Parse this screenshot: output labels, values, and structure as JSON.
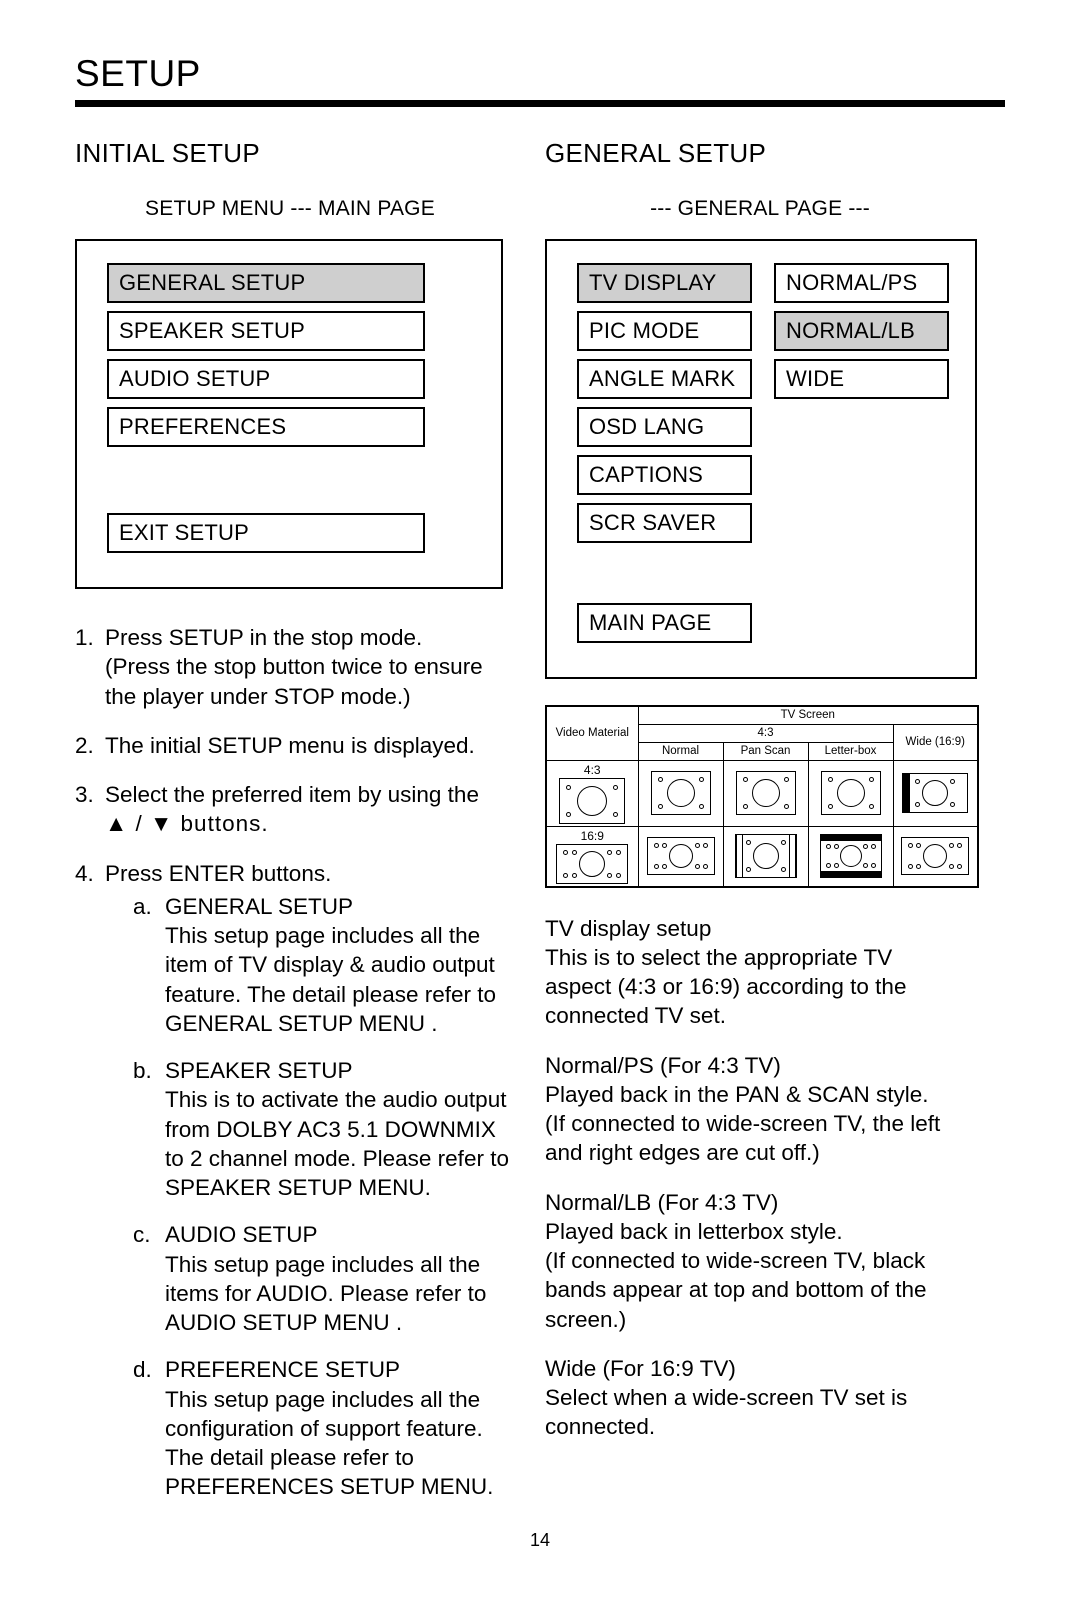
{
  "header": {
    "title": "SETUP"
  },
  "left_column": {
    "section_title": "INITIAL SETUP",
    "menu_caption": "SETUP MENU --- MAIN PAGE",
    "osd_menu": {
      "items": [
        {
          "label": "GENERAL SETUP",
          "selected": true
        },
        {
          "label": "SPEAKER SETUP",
          "selected": false
        },
        {
          "label": "AUDIO SETUP",
          "selected": false
        },
        {
          "label": "PREFERENCES",
          "selected": false
        }
      ],
      "exit_label": "EXIT SETUP"
    },
    "steps": [
      {
        "num": "1.",
        "lines": [
          "Press SETUP in the stop mode.",
          "(Press the stop button twice to ensure",
          "the player under STOP mode.)"
        ]
      },
      {
        "num": "2.",
        "lines": [
          "The initial SETUP menu is displayed."
        ]
      },
      {
        "num": "3.",
        "lines": [
          "Select the preferred item by using the",
          "▲ / ▼ buttons."
        ]
      },
      {
        "num": "4.",
        "lines": [
          "Press ENTER buttons."
        ],
        "subitems": [
          {
            "marker": "a.",
            "heading": "GENERAL SETUP",
            "lines": [
              "This setup page includes all the",
              "item of TV display & audio output",
              "feature.  The detail please refer to",
              "GENERAL SETUP MENU ."
            ]
          },
          {
            "marker": "b.",
            "heading": "SPEAKER SETUP",
            "lines": [
              "This is to activate the audio output",
              "from DOLBY AC3 5.1 DOWNMIX",
              "to 2 channel mode.  Please refer to",
              "SPEAKER SETUP MENU."
            ]
          },
          {
            "marker": "c.",
            "heading": "AUDIO SETUP",
            "lines": [
              "This setup page includes all the",
              "items for AUDIO.  Please refer to",
              "AUDIO SETUP MENU ."
            ]
          },
          {
            "marker": "d.",
            "heading": "PREFERENCE SETUP",
            "lines": [
              "This setup page includes all the",
              "configuration of support feature.",
              "The detail please refer to",
              "PREFERENCES SETUP MENU."
            ]
          }
        ]
      }
    ]
  },
  "right_column": {
    "section_title": "GENERAL SETUP",
    "menu_caption": "--- GENERAL PAGE ---",
    "osd_menu": {
      "left_items": [
        {
          "label": "TV DISPLAY",
          "selected": true
        },
        {
          "label": "PIC MODE",
          "selected": false
        },
        {
          "label": "ANGLE MARK",
          "selected": false
        },
        {
          "label": "OSD LANG",
          "selected": false
        },
        {
          "label": "CAPTIONS",
          "selected": false
        },
        {
          "label": "SCR SAVER",
          "selected": false
        }
      ],
      "right_items": [
        {
          "label": "NORMAL/PS",
          "selected": false
        },
        {
          "label": "NORMAL/LB",
          "selected": true
        },
        {
          "label": "WIDE",
          "selected": false
        }
      ],
      "mainpage_label": "MAIN PAGE"
    },
    "tv_table": {
      "corner_label": "Video Material",
      "screen_header": "TV Screen",
      "group_43": "4:3",
      "group_wide": "Wide (16:9)",
      "subheaders": [
        "Normal",
        "Pan Scan",
        "Letter-box"
      ],
      "rows": [
        {
          "material": "4:3",
          "cells": [
            "normal-43",
            "panscan-43",
            "letterbox-43",
            "wide-43-pillar"
          ]
        },
        {
          "material": "16:9",
          "cells": [
            "normal-169",
            "panscan-169",
            "letterbox-169",
            "wide-169"
          ]
        }
      ]
    },
    "paragraphs": [
      {
        "lines": [
          "TV display setup",
          "This is to select the appropriate TV",
          "aspect (4:3 or 16:9) according to the",
          "connected TV set."
        ]
      },
      {
        "lines": [
          "Normal/PS (For 4:3 TV)",
          "Played back in the PAN & SCAN style.",
          "(If connected to wide-screen TV, the left",
          "and right edges are cut off.)"
        ]
      },
      {
        "lines": [
          "Normal/LB (For 4:3 TV)",
          "Played back in letterbox style.",
          "(If connected to wide-screen TV, black",
          "bands appear at top and bottom of the",
          "screen.)"
        ]
      },
      {
        "lines": [
          "Wide (For 16:9 TV)",
          "Select when a wide-screen TV set is",
          "connected."
        ]
      }
    ]
  },
  "footer": {
    "page_number": "14"
  },
  "colors": {
    "selected_highlight": "#cfcfcf",
    "rule": "#000000",
    "page_background": "#ffffff"
  }
}
